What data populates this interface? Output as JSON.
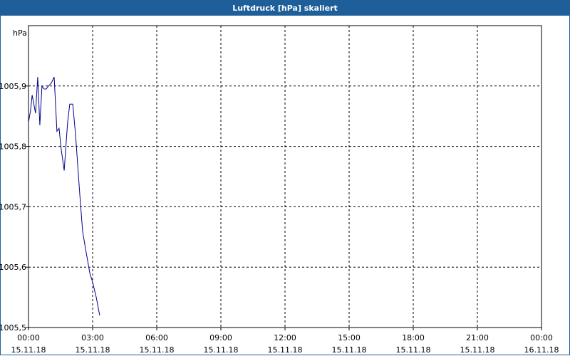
{
  "window": {
    "title": "Luftdruck [hPa] skaliert"
  },
  "chart_data": {
    "type": "line",
    "ylabel": "hPa",
    "ylim": [
      1005.5,
      1006.0
    ],
    "yticks": [
      {
        "value": 1005.5,
        "label": "1005,5"
      },
      {
        "value": 1005.6,
        "label": "1005,6"
      },
      {
        "value": 1005.7,
        "label": "1005,7"
      },
      {
        "value": 1005.8,
        "label": "1005,8"
      },
      {
        "value": 1005.9,
        "label": "1005,9"
      }
    ],
    "xlim_hours": [
      0,
      24
    ],
    "xticks": [
      {
        "hour": 0,
        "time": "00:00",
        "date": "15.11.18"
      },
      {
        "hour": 3,
        "time": "03:00",
        "date": "15.11.18"
      },
      {
        "hour": 6,
        "time": "06:00",
        "date": "15.11.18"
      },
      {
        "hour": 9,
        "time": "09:00",
        "date": "15.11.18"
      },
      {
        "hour": 12,
        "time": "12:00",
        "date": "15.11.18"
      },
      {
        "hour": 15,
        "time": "15:00",
        "date": "15.11.18"
      },
      {
        "hour": 18,
        "time": "18:00",
        "date": "15.11.18"
      },
      {
        "hour": 21,
        "time": "21:00",
        "date": "15.11.18"
      },
      {
        "hour": 24,
        "time": "00:00",
        "date": "16.11.18"
      }
    ],
    "grid": true,
    "line_color": "#00008b",
    "series": [
      {
        "x": [
          0,
          0.1,
          0.17,
          0.33,
          0.43,
          0.53,
          0.63,
          0.73,
          0.83,
          0.93,
          1.07,
          1.2,
          1.33,
          1.43,
          1.53,
          1.67,
          1.83,
          1.93,
          2.07,
          2.2,
          2.3,
          2.4,
          2.53,
          2.67,
          2.77,
          2.87,
          3.0,
          3.17,
          3.33
        ],
        "y": [
          1005.84,
          1005.86,
          1005.885,
          1005.855,
          1005.915,
          1005.835,
          1005.9,
          1005.895,
          1005.895,
          1005.9,
          1005.905,
          1005.915,
          1005.825,
          1005.83,
          1005.795,
          1005.76,
          1005.84,
          1005.87,
          1005.87,
          1005.82,
          1005.77,
          1005.72,
          1005.66,
          1005.63,
          1005.61,
          1005.59,
          1005.575,
          1005.55,
          1005.52
        ]
      }
    ]
  }
}
